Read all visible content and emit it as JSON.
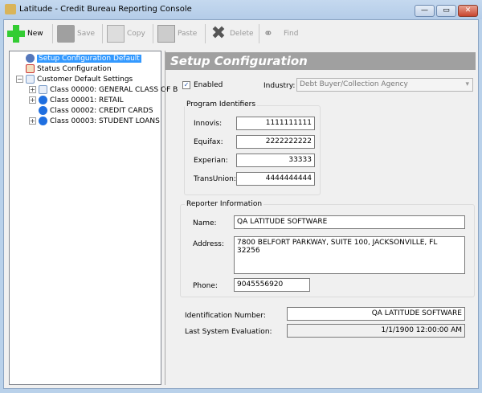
{
  "window": {
    "title": "Latitude - Credit Bureau Reporting Console",
    "minimize": "—",
    "maximize": "▭",
    "close": "✕"
  },
  "toolbar": [
    {
      "label": "New",
      "icon": "plus-icon",
      "enabled": true
    },
    {
      "label": "Save",
      "icon": "floppy-icon",
      "enabled": false
    },
    {
      "label": "Copy",
      "icon": "copy-icon",
      "enabled": false
    },
    {
      "label": "Paste",
      "icon": "clipboard-icon",
      "enabled": false
    },
    {
      "label": "Delete",
      "icon": "x-icon",
      "enabled": false
    },
    {
      "label": "Find",
      "icon": "binoculars-icon",
      "enabled": false
    }
  ],
  "tree": [
    {
      "label": "Setup Configuration Default",
      "icon": "gear-icon",
      "selected": true
    },
    {
      "label": "Status Configuration",
      "icon": "checklist-icon"
    },
    {
      "label": "Customer Default Settings",
      "icon": "document-icon",
      "expanded": true
    },
    {
      "label": "Class 00000: GENERAL CLASS OF B",
      "icon": "document-icon"
    },
    {
      "label": "Class 00001: RETAIL",
      "icon": "refresh-icon"
    },
    {
      "label": "Class 00002: CREDIT CARDS",
      "icon": "refresh-icon"
    },
    {
      "label": "Class 00003: STUDENT LOANS",
      "icon": "refresh-icon"
    }
  ],
  "main": {
    "header": "Setup Configuration",
    "enabled_label": "Enabled",
    "enabled": true,
    "industry_label": "Industry:",
    "industry_value": "Debt Buyer/Collection Agency",
    "program": {
      "title": "Program Identifiers",
      "rows": [
        {
          "label": "Innovis:",
          "value": "1111111111"
        },
        {
          "label": "Equifax:",
          "value": "2222222222"
        },
        {
          "label": "Experian:",
          "value": "33333"
        },
        {
          "label": "TransUnion:",
          "value": "4444444444"
        }
      ]
    },
    "reporter": {
      "title": "Reporter Information",
      "name_label": "Name:",
      "name": "QA LATITUDE SOFTWARE",
      "address_label": "Address:",
      "address": "7800 BELFORT PARKWAY, SUITE 100, JACKSONVILLE, FL 32256",
      "phone_label": "Phone:",
      "phone": "9045556920"
    },
    "id_label": "Identification Number:",
    "id_value": "QA LATITUDE SOFTWARE",
    "eval_label": "Last System Evaluation:",
    "eval_value": "1/1/1900 12:00:00 AM"
  }
}
